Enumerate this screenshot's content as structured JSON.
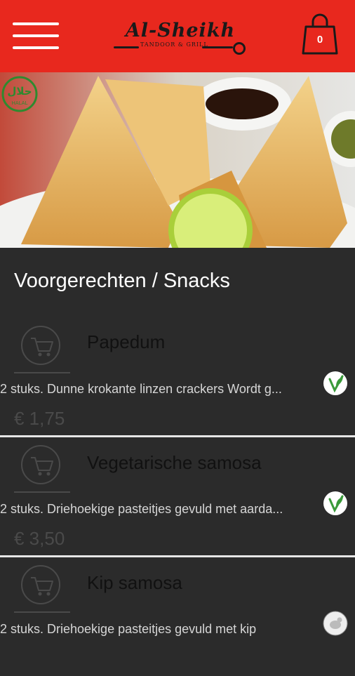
{
  "header": {
    "menu_icon": "hamburger-menu-icon",
    "logo_title": "Al-Sheikh",
    "logo_subtitle": "TANDOOR & GRILL",
    "cart_icon": "shopping-bag-icon",
    "cart_count": "0",
    "bg_color": "#e8281e"
  },
  "hero": {
    "image": "samosa-plate-photo",
    "badge_icon": "halal-badge-icon",
    "badge_text_ar": "حلال",
    "badge_text_en": "HALAL"
  },
  "section": {
    "title": "Voorgerechten / Snacks"
  },
  "items": [
    {
      "name": "Papedum",
      "description": "2 stuks. Dunne krokante linzen crackers Wordt g...",
      "price": "€ 1,75",
      "tag_icon": "vegetarian-leaf-icon"
    },
    {
      "name": "Vegetarische samosa",
      "description": "2 stuks. Driehoekige pasteitjes gevuld met aarda...",
      "price": "€ 3,50",
      "tag_icon": "vegetarian-leaf-icon"
    },
    {
      "name": "Kip samosa",
      "description": "2 stuks. Driehoekige pasteitjes gevuld met kip",
      "price": "",
      "tag_icon": "chicken-icon"
    }
  ]
}
